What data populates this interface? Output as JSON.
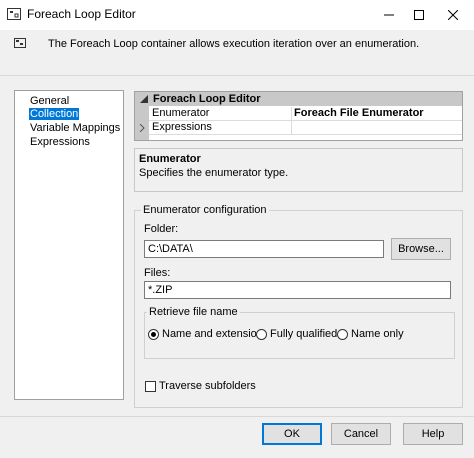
{
  "window": {
    "title": "Foreach Loop Editor",
    "icon": "foreach-loop-icon",
    "minimize_icon": "minimize-icon",
    "maximize_icon": "maximize-icon",
    "close_icon": "close-icon"
  },
  "description": {
    "icon": "container-icon",
    "text": "The Foreach Loop container allows execution iteration over an enumeration."
  },
  "nav": {
    "items": [
      {
        "label": "General",
        "selected": false
      },
      {
        "label": "Collection",
        "selected": true
      },
      {
        "label": "Variable Mappings",
        "selected": false
      },
      {
        "label": "Expressions",
        "selected": false
      }
    ],
    "selected_color": "#0078d7"
  },
  "property_grid": {
    "header": "Foreach Loop Editor",
    "rows": [
      {
        "name": "Enumerator",
        "value": "Foreach File Enumerator"
      },
      {
        "name": "Expressions",
        "value": ""
      }
    ]
  },
  "help": {
    "title": "Enumerator",
    "text": "Specifies the enumerator type."
  },
  "config": {
    "legend": "Enumerator configuration",
    "folder_label": "Folder:",
    "folder_value": "C:\\DATA\\",
    "browse_label": "Browse...",
    "files_label": "Files:",
    "files_value": "*.ZIP",
    "retrieve": {
      "legend": "Retrieve file name",
      "options": [
        {
          "label": "Name and extension",
          "selected": true
        },
        {
          "label": "Fully qualified",
          "selected": false
        },
        {
          "label": "Name only",
          "selected": false
        }
      ]
    },
    "traverse_label": "Traverse subfolders",
    "traverse_checked": false
  },
  "buttons": {
    "ok": "OK",
    "cancel": "Cancel",
    "help": "Help"
  }
}
